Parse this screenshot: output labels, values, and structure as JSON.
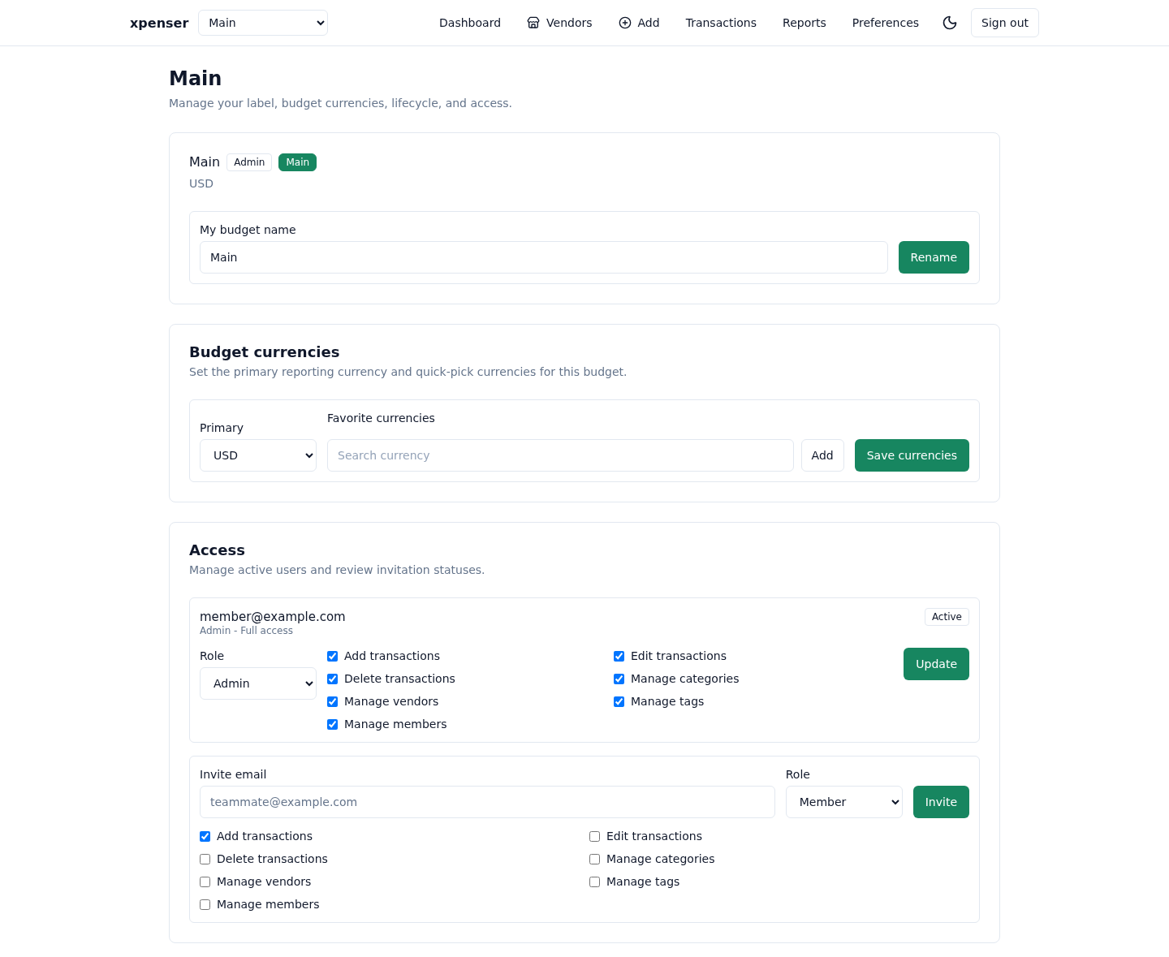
{
  "header": {
    "brand": "xpenser",
    "budget_select": {
      "value": "Main"
    },
    "nav": [
      {
        "label": "Dashboard",
        "kind": "link"
      },
      {
        "label": "Vendors",
        "kind": "icon_link"
      },
      {
        "label": "Add",
        "kind": "icon_link"
      },
      {
        "label": "Transactions",
        "kind": "link"
      },
      {
        "label": "Reports",
        "kind": "link"
      },
      {
        "label": "Preferences",
        "kind": "link"
      }
    ],
    "sign_out": "Sign out"
  },
  "page": {
    "title": "Main",
    "subtitle": "Manage your label, budget currencies, lifecycle, and access."
  },
  "budget_card": {
    "name": "Main",
    "badges": [
      {
        "label": "Admin",
        "kind": "outline"
      },
      {
        "label": "Main",
        "kind": "filled"
      }
    ],
    "currency": "USD",
    "rename": {
      "label": "My budget name",
      "value": "Main",
      "button": "Rename"
    }
  },
  "currencies_card": {
    "title": "Budget currencies",
    "subtitle": "Set the primary reporting currency and quick-pick currencies for this budget.",
    "primary": {
      "label": "Primary",
      "value": "USD"
    },
    "favorites": {
      "label": "Favorite currencies",
      "placeholder": "Search currency",
      "add_button": "Add"
    },
    "save_button": "Save currencies"
  },
  "access_card": {
    "title": "Access",
    "subtitle": "Manage active users and review invitation statuses.",
    "members": [
      {
        "email": "member@example.com",
        "role_description": "Admin - Full access",
        "status": "Active",
        "role_label": "Role",
        "role": "Admin",
        "permissions": [
          {
            "label": "Add transactions",
            "checked": true
          },
          {
            "label": "Edit transactions",
            "checked": true
          },
          {
            "label": "Delete transactions",
            "checked": true
          },
          {
            "label": "Manage categories",
            "checked": true
          },
          {
            "label": "Manage vendors",
            "checked": true
          },
          {
            "label": "Manage tags",
            "checked": true
          },
          {
            "label": "Manage members",
            "checked": true
          }
        ],
        "button": "Update"
      }
    ],
    "invite": {
      "email_label": "Invite email",
      "placeholder": "teammate@example.com",
      "role_label": "Role",
      "role": "Member",
      "button": "Invite",
      "permissions": [
        {
          "label": "Add transactions",
          "checked": true
        },
        {
          "label": "Edit transactions",
          "checked": false
        },
        {
          "label": "Delete transactions",
          "checked": false
        },
        {
          "label": "Manage categories",
          "checked": false
        },
        {
          "label": "Manage vendors",
          "checked": false
        },
        {
          "label": "Manage tags",
          "checked": false
        },
        {
          "label": "Manage members",
          "checked": false
        }
      ]
    }
  }
}
